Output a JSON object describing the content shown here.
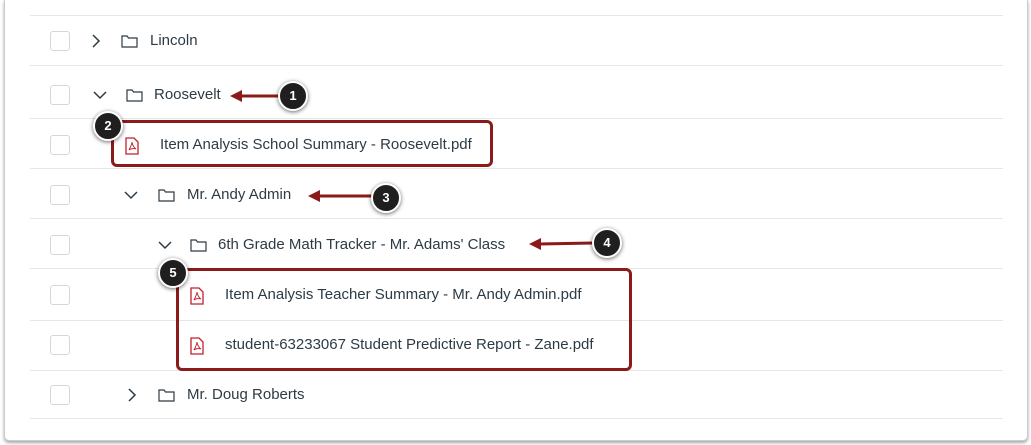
{
  "rows": [
    {
      "label": "Lincoln",
      "type": "folder",
      "state": "collapsed"
    },
    {
      "label": "Roosevelt",
      "type": "folder",
      "state": "expanded"
    },
    {
      "label": "Item Analysis School Summary - Roosevelt.pdf",
      "type": "pdf"
    },
    {
      "label": "Mr. Andy Admin",
      "type": "folder",
      "state": "expanded"
    },
    {
      "label": "6th Grade Math Tracker - Mr. Adams' Class",
      "type": "folder",
      "state": "expanded"
    },
    {
      "label": "Item Analysis Teacher Summary - Mr. Andy Admin.pdf",
      "type": "pdf"
    },
    {
      "label": "student-63233067 Student Predictive Report - Zane.pdf",
      "type": "pdf"
    },
    {
      "label": "Mr. Doug Roberts",
      "type": "folder",
      "state": "collapsed"
    }
  ],
  "callouts": [
    "1",
    "2",
    "3",
    "4",
    "5"
  ],
  "colors": {
    "callout": "#8b1a1a",
    "pdf_icon": "#c21f2c",
    "text": "#2d3b45",
    "badge": "#1f1f1f"
  }
}
